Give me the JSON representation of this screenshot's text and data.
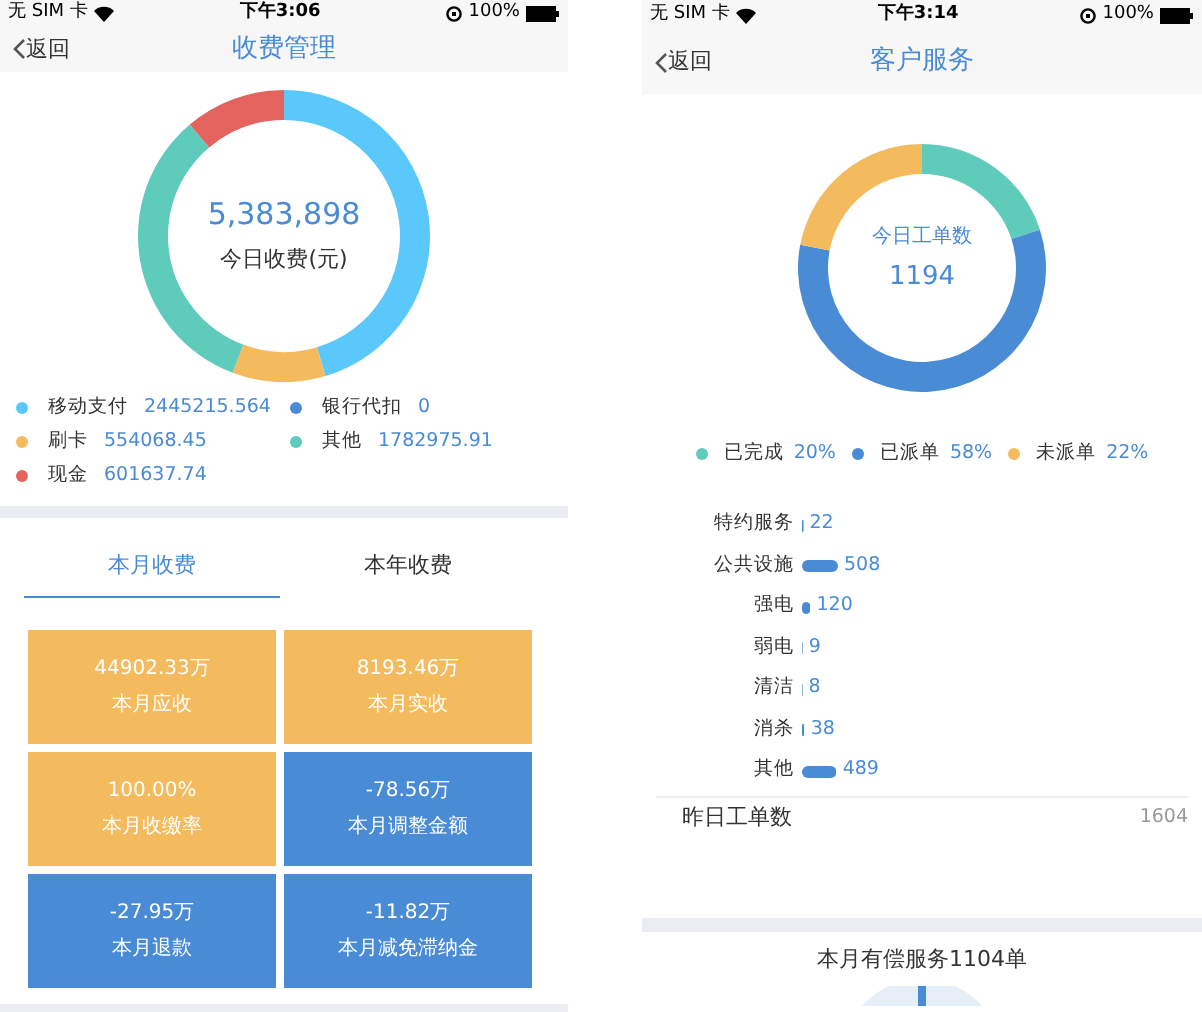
{
  "screens": [
    {
      "kind": "fees",
      "status_bar": {
        "carrier": "无 SIM 卡",
        "time": "下午3:06",
        "battery": "100%"
      },
      "nav": {
        "back": "返回",
        "title": "收费管理"
      },
      "donut": {
        "center_value": "5,383,898",
        "center_label": "今日收费(元)",
        "chart_data": {
          "type": "donut",
          "categories": [
            "移动支付",
            "银行代扣",
            "刷卡",
            "其他",
            "现金"
          ],
          "values": [
            45.42,
            0,
            10.29,
            33.12,
            11.17
          ]
        }
      },
      "legend": [
        {
          "value": "2445215.564",
          "color": "#5ac8fa"
        },
        {
          "value": "0",
          "color": "#4a8bd6"
        },
        {
          "value": "554068.45",
          "color": "#f4bb5e"
        },
        {
          "value": "1782975.91",
          "color": "#5ecbbb"
        },
        {
          "value": "601637.74",
          "color": "#e5635f"
        }
      ],
      "tabs": [
        {
          "label": "本月收费",
          "selected": true
        },
        {
          "label": "本年收费",
          "selected": false
        }
      ],
      "tiles": [
        {
          "value": "44902.33万",
          "label": "本月应收",
          "color": "#f4bb5e"
        },
        {
          "value": "8193.46万",
          "label": "本月实收",
          "color": "#f4bb5e"
        },
        {
          "value": "100.00%",
          "label": "本月收缴率",
          "color": "#f4bb5e"
        },
        {
          "value": "-78.56万",
          "label": "本月调整金额",
          "color": "#4a8bd6"
        },
        {
          "value": "-27.95万",
          "label": "本月退款",
          "color": "#4a8bd6"
        },
        {
          "value": "-11.82万",
          "label": "本月减免滞纳金",
          "color": "#4a8bd6"
        }
      ]
    },
    {
      "kind": "service",
      "status_bar": {
        "carrier": "无 SIM 卡",
        "time": "下午3:14",
        "battery": "100%"
      },
      "nav": {
        "back": "返回",
        "title": "客户服务"
      },
      "donut": {
        "center_label": "今日工单数",
        "center_value": "1194",
        "chart_data": {
          "type": "donut",
          "categories": [
            "已完成",
            "已派单",
            "未派单"
          ],
          "values": [
            20,
            58,
            22
          ]
        }
      },
      "legend": [
        {
          "value": "20%",
          "color": "#5ecbbb"
        },
        {
          "value": "58%",
          "color": "#4a8bd6"
        },
        {
          "value": "22%",
          "color": "#f4bb5e"
        }
      ],
      "bars": {
        "chart_data": {
          "type": "bar",
          "orientation": "horizontal",
          "categories": [
            "特约服务",
            "公共设施",
            "强电",
            "弱电",
            "清洁",
            "消杀",
            "其他"
          ],
          "values": [
            22,
            508,
            120,
            9,
            8,
            38,
            489
          ],
          "data_labels": true
        }
      },
      "summary": {
        "label": "昨日工单数",
        "value": "1604"
      },
      "section_title": "本月有偿服务1104单"
    }
  ]
}
